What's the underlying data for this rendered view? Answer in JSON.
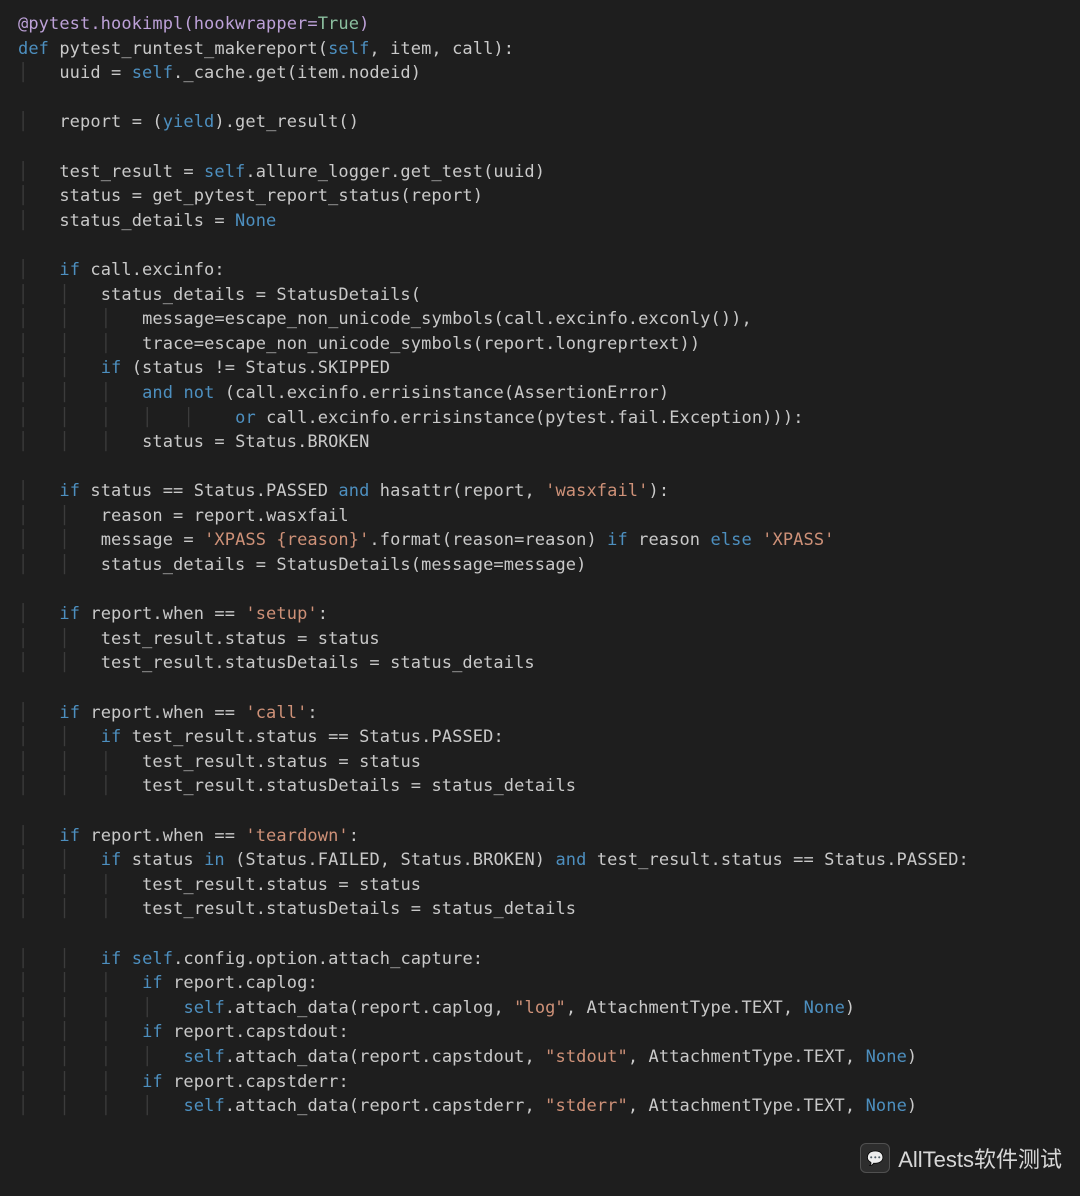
{
  "code": {
    "lines": [
      {
        "t": "@pytest.hookimpl(hookwrapper=",
        "v": "True",
        "t2": ")",
        "cls": "dec",
        "valcls": "num"
      },
      {
        "raw": "<span class='kw'>def</span> pytest_runtest_makereport(<span class='kv'>self</span>, item, call):"
      },
      {
        "raw": "    uuid = <span class='kv'>self</span>._cache.get(item.nodeid)"
      },
      {
        "raw": ""
      },
      {
        "raw": "    report = (<span class='kw'>yield</span>).get_result()"
      },
      {
        "raw": ""
      },
      {
        "raw": "    test_result = <span class='kv'>self</span>.allure_logger.get_test(uuid)"
      },
      {
        "raw": "    status = get_pytest_report_status(report)"
      },
      {
        "raw": "    status_details = <span class='kv'>None</span>"
      },
      {
        "raw": ""
      },
      {
        "raw": "    <span class='kw'>if</span> call.excinfo:"
      },
      {
        "raw": "        status_details = StatusDetails("
      },
      {
        "raw": "            message=escape_non_unicode_symbols(call.excinfo.exconly()),"
      },
      {
        "raw": "            trace=escape_non_unicode_symbols(report.longreprtext))"
      },
      {
        "raw": "        <span class='kw'>if</span> (status != Status.SKIPPED"
      },
      {
        "raw": "            <span class='kw'>and</span> <span class='kw'>not</span> (call.excinfo.errisinstance(AssertionError)"
      },
      {
        "raw": "                     <span class='kw'>or</span> call.excinfo.errisinstance(pytest.fail.Exception))):"
      },
      {
        "raw": "            status = Status.BROKEN"
      },
      {
        "raw": ""
      },
      {
        "raw": "    <span class='kw'>if</span> status == Status.PASSED <span class='kw'>and</span> hasattr(report, <span class='str'>'wasxfail'</span>):"
      },
      {
        "raw": "        reason = report.wasxfail"
      },
      {
        "raw": "        message = <span class='str'>'XPASS {reason}'</span>.format(reason=reason) <span class='kw'>if</span> reason <span class='kw'>else</span> <span class='str'>'XPASS'</span>"
      },
      {
        "raw": "        status_details = StatusDetails(message=message)"
      },
      {
        "raw": ""
      },
      {
        "raw": "    <span class='kw'>if</span> report.when == <span class='str'>'setup'</span>:"
      },
      {
        "raw": "        test_result.status = status"
      },
      {
        "raw": "        test_result.statusDetails = status_details"
      },
      {
        "raw": ""
      },
      {
        "raw": "    <span class='kw'>if</span> report.when == <span class='str'>'call'</span>:"
      },
      {
        "raw": "        <span class='kw'>if</span> test_result.status == Status.PASSED:"
      },
      {
        "raw": "            test_result.status = status"
      },
      {
        "raw": "            test_result.statusDetails = status_details"
      },
      {
        "raw": ""
      },
      {
        "raw": "    <span class='kw'>if</span> report.when == <span class='str'>'teardown'</span>:"
      },
      {
        "raw": "        <span class='kw'>if</span> status <span class='kw'>in</span> (Status.FAILED, Status.BROKEN) <span class='kw'>and</span> test_result.status == Status.PASSED:"
      },
      {
        "raw": "            test_result.status = status"
      },
      {
        "raw": "            test_result.statusDetails = status_details"
      },
      {
        "raw": ""
      },
      {
        "raw": "        <span class='kw'>if</span> <span class='kv'>self</span>.config.option.attach_capture:"
      },
      {
        "raw": "            <span class='kw'>if</span> report.caplog:"
      },
      {
        "raw": "                <span class='kv'>self</span>.attach_data(report.caplog, <span class='str'>\"log\"</span>, AttachmentType.TEXT, <span class='kv'>None</span>)"
      },
      {
        "raw": "            <span class='kw'>if</span> report.capstdout:"
      },
      {
        "raw": "                <span class='kv'>self</span>.attach_data(report.capstdout, <span class='str'>\"stdout\"</span>, AttachmentType.TEXT, <span class='kv'>None</span>)"
      },
      {
        "raw": "            <span class='kw'>if</span> report.capstderr:"
      },
      {
        "raw": "                <span class='kv'>self</span>.attach_data(report.capstderr, <span class='str'>\"stderr\"</span>, AttachmentType.TEXT, <span class='kv'>None</span>)"
      }
    ]
  },
  "watermark": {
    "text": "AllTests软件测试",
    "icon": "💬"
  }
}
